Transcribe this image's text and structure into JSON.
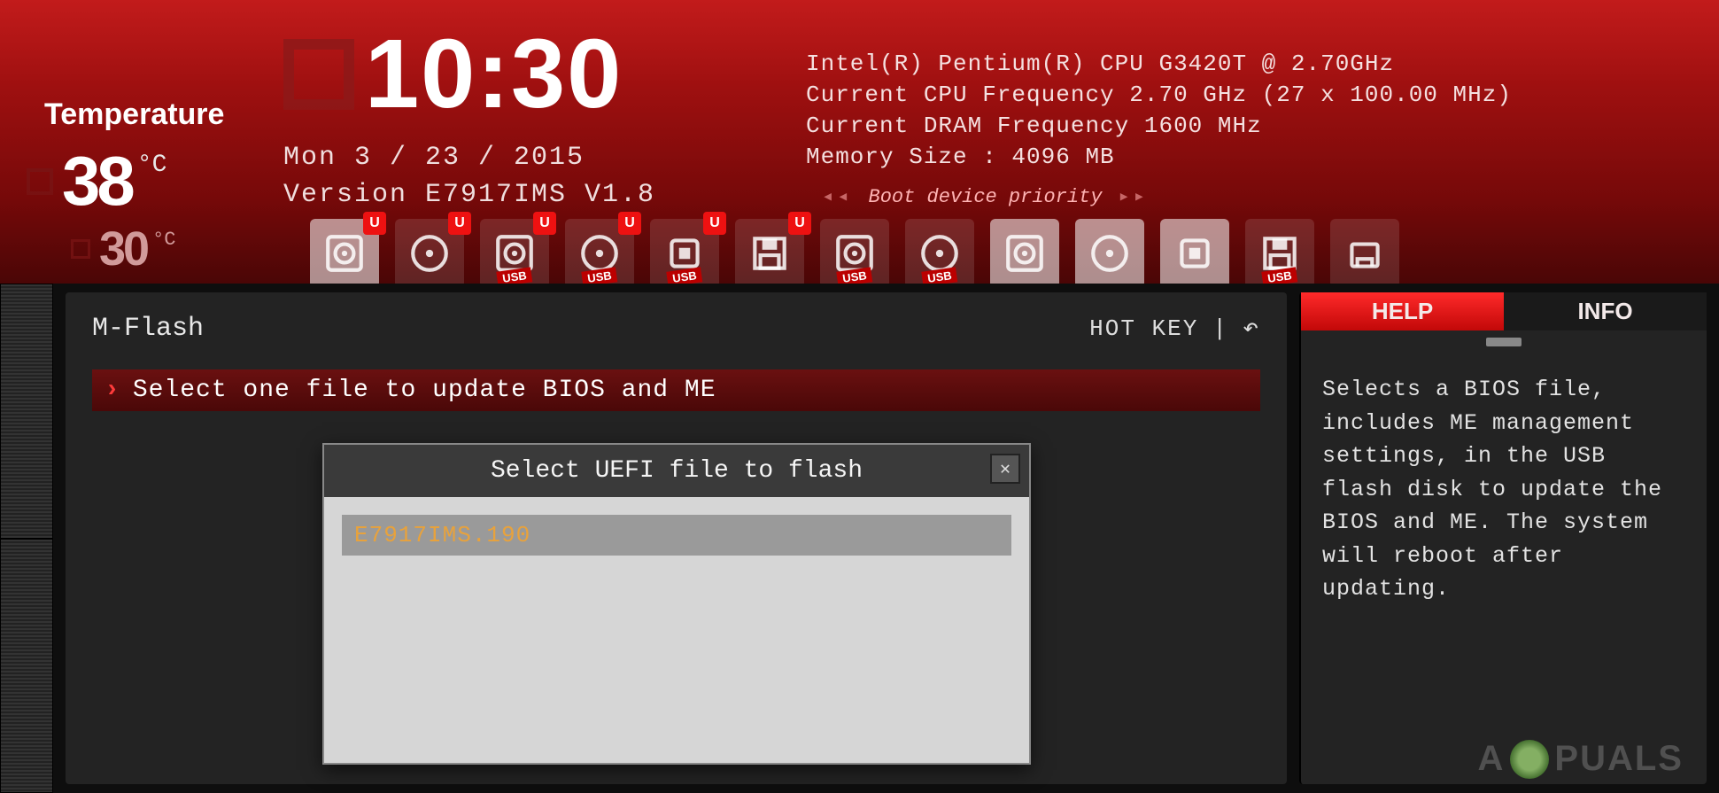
{
  "temperature": {
    "label": "Temperature",
    "primary": "38",
    "primary_unit": "°C",
    "secondary": "30",
    "secondary_unit": "°C"
  },
  "clock": {
    "time": "10:30",
    "date_line": "Mon  3 / 23 / 2015",
    "version_line": "Version E7917IMS V1.8"
  },
  "system": {
    "cpu": "Intel(R) Pentium(R) CPU G3420T @ 2.70GHz",
    "cpu_freq": "Current CPU Frequency 2.70 GHz (27 x 100.00 MHz)",
    "dram_freq": "Current DRAM Frequency 1600 MHz",
    "mem_size": "Memory Size : 4096 MB"
  },
  "boot": {
    "label": "Boot device priority",
    "devices": [
      {
        "type": "hdd",
        "u_badge": true,
        "usb_tag": false,
        "bright": true
      },
      {
        "type": "optical",
        "u_badge": true,
        "usb_tag": false,
        "bright": false
      },
      {
        "type": "hdd",
        "u_badge": true,
        "usb_tag": true,
        "bright": false
      },
      {
        "type": "optical",
        "u_badge": true,
        "usb_tag": true,
        "bright": false
      },
      {
        "type": "chip",
        "u_badge": true,
        "usb_tag": true,
        "bright": false
      },
      {
        "type": "floppy",
        "u_badge": true,
        "usb_tag": false,
        "bright": false
      },
      {
        "type": "hdd",
        "u_badge": false,
        "usb_tag": true,
        "bright": false
      },
      {
        "type": "optical",
        "u_badge": false,
        "usb_tag": true,
        "bright": false
      },
      {
        "type": "hdd",
        "u_badge": false,
        "usb_tag": false,
        "bright": true
      },
      {
        "type": "optical",
        "u_badge": false,
        "usb_tag": false,
        "bright": true
      },
      {
        "type": "chip",
        "u_badge": false,
        "usb_tag": false,
        "bright": true
      },
      {
        "type": "floppy",
        "u_badge": false,
        "usb_tag": true,
        "bright": false
      },
      {
        "type": "network",
        "u_badge": false,
        "usb_tag": false,
        "bright": false
      }
    ]
  },
  "page": {
    "title": "M-Flash",
    "hotkey": "HOT KEY",
    "menu_item": "Select one file to update BIOS and ME"
  },
  "modal": {
    "title": "Select UEFI file to flash",
    "files": [
      "E7917IMS.190"
    ]
  },
  "side": {
    "tab_help": "HELP",
    "tab_info": "INFO",
    "help_text": "Selects a BIOS file, includes ME management settings, in the USB flash disk to update the BIOS and ME.  The system will reboot after updating."
  },
  "watermark": "A  PUALS"
}
